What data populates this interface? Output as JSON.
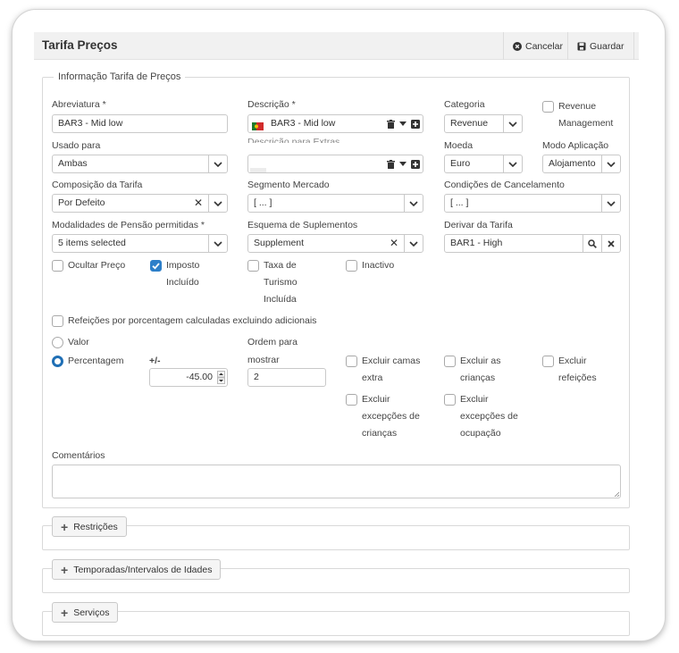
{
  "header": {
    "title": "Tarifa Preços",
    "cancel_label": "Cancelar",
    "save_label": "Guardar"
  },
  "section": {
    "legend": "Informação Tarifa de Preços"
  },
  "fields": {
    "abreviatura": {
      "label": "Abreviatura *",
      "value": "BAR3 - Mid low"
    },
    "descricao": {
      "label": "Descrição *",
      "value": "BAR3 - Mid low"
    },
    "categoria": {
      "label": "Categoria",
      "value": "Revenue"
    },
    "revenue_management": {
      "label_line1": "Revenue",
      "label_line2": "Management"
    },
    "usado_para": {
      "label": "Usado para",
      "value": "Ambas"
    },
    "descricao2": {
      "label": "Descrição para Extras"
    },
    "moeda": {
      "label": "Moeda",
      "value": "Euro"
    },
    "modo_aplicacao": {
      "label": "Modo Aplicação",
      "value": "Alojamento"
    },
    "composicao": {
      "label": "Composição da Tarifa",
      "value": "Por Defeito"
    },
    "segmento": {
      "label": "Segmento Mercado",
      "value": "[ ... ]"
    },
    "condicoes": {
      "label": "Condições de Cancelamento",
      "value": "[ ... ]"
    },
    "modalidades": {
      "label": "Modalidades de Pensão permitidas *",
      "value": "5 items selected"
    },
    "esquema": {
      "label": "Esquema de Suplementos",
      "value": "Supplement"
    },
    "derivar": {
      "label": "Derivar da Tarifa",
      "value": "BAR1 - High"
    },
    "sinal": {
      "label": "+/-",
      "value": "-45.00"
    },
    "ordem": {
      "label_line1": "Ordem para",
      "label_line2": "mostrar",
      "value": "2"
    },
    "comentarios": {
      "label": "Comentários",
      "value": ""
    }
  },
  "checkboxes": {
    "ocultar_preco": {
      "label": "Ocultar Preço",
      "checked": false
    },
    "imposto_incluido": {
      "label_line1": "Imposto",
      "label_line2": "Incluído",
      "checked": true
    },
    "taxa_turismo": {
      "label_line1": "Taxa de",
      "label_line2": "Turismo",
      "label_line3": "Incluída",
      "checked": false
    },
    "inactivo": {
      "label": "Inactivo",
      "checked": false
    },
    "refeicoes_pct": {
      "label": "Refeições por porcentagem calculadas excluindo adicionais",
      "checked": false
    },
    "excluir_camas": {
      "label_line1": "Excluir camas",
      "label_line2": "extra",
      "checked": false
    },
    "excluir_criancas": {
      "label_line1": "Excluir as",
      "label_line2": "crianças",
      "checked": false
    },
    "excluir_refeicoes": {
      "label_line1": "Excluir",
      "label_line2": "refeições",
      "checked": false
    },
    "excluir_exc_criancas": {
      "label_line1": "Excluir",
      "label_line2": "excepções de",
      "label_line3": "crianças",
      "checked": false
    },
    "excluir_exc_ocupacao": {
      "label_line1": "Excluir",
      "label_line2": "excepções de",
      "label_line3": "ocupação",
      "checked": false
    }
  },
  "radios": {
    "valor": {
      "label": "Valor",
      "selected": false
    },
    "percentagem": {
      "label": "Percentagem",
      "selected": true
    }
  },
  "collapsibles": {
    "restricoes": "Restrições",
    "temporadas": "Temporadas/Intervalos de Idades",
    "servicos": "Serviços"
  },
  "colors": {
    "accent": "#2d7fc9",
    "radio_selected": "#1f6fb5",
    "flag_green": "#1f7a2e",
    "flag_red": "#d12b2b"
  },
  "icons": {
    "cancel": "times-circle-icon",
    "save": "floppy-disk-icon",
    "flag": "portugal-flag-icon",
    "trash": "trash-icon",
    "add": "plus-square-icon",
    "search": "search-icon",
    "clear": "close-icon",
    "chevron": "chevron-down-icon"
  }
}
